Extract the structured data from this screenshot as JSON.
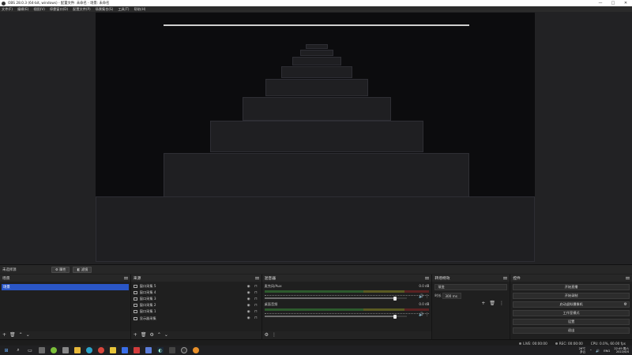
{
  "window": {
    "title": "OBS 28.0.3 (64-bit, windows) - 配置文件: 未命名 - 场景: 未命名",
    "controls": [
      "—",
      "□",
      "✕"
    ]
  },
  "menu": [
    "文件(F)",
    "编辑(E)",
    "视图(V)",
    "停靠窗口(D)",
    "配置文件(P)",
    "场景集合(S)",
    "工具(T)",
    "帮助(H)"
  ],
  "source_bar": {
    "label": "未选择源",
    "properties": "属性",
    "filters": "滤镜"
  },
  "scenes": {
    "title": "场景",
    "items": [
      "场景"
    ]
  },
  "sources": {
    "title": "来源",
    "items": [
      {
        "name": "窗口采集 5",
        "icon": "window-capture-icon"
      },
      {
        "name": "窗口采集 4",
        "icon": "window-capture-icon"
      },
      {
        "name": "窗口采集 3",
        "icon": "window-capture-icon"
      },
      {
        "name": "窗口采集 2",
        "icon": "window-capture-icon"
      },
      {
        "name": "窗口采集 1",
        "icon": "window-capture-icon"
      },
      {
        "name": "显示器采集",
        "icon": "display-capture-icon"
      }
    ]
  },
  "mixer": {
    "title": "混音器",
    "channels": [
      {
        "name": "麦克风/Aux",
        "db": "0.0 dB",
        "level": 0.92
      },
      {
        "name": "桌面音频",
        "db": "0.0 dB",
        "level": 0.92
      }
    ]
  },
  "transitions": {
    "title": "转场特效",
    "selected": "渐变",
    "duration_label": "时长",
    "duration_value": "300 ms"
  },
  "controls": {
    "title": "控件",
    "buttons": [
      "开始直播",
      "开始录制",
      "启动虚拟摄像机",
      "工作室模式",
      "设置",
      "退出"
    ]
  },
  "status": {
    "live": "LIVE: 00:00:00",
    "rec": "REC: 00:00:00",
    "cpu": "CPU: 0.0%, 60.00 fps"
  },
  "taskbar": {
    "tray_weather": "26℃",
    "tray_weather2": "多云",
    "tray_lang": "ENG",
    "time": "22:49 周六",
    "date": "2022/6/4"
  }
}
